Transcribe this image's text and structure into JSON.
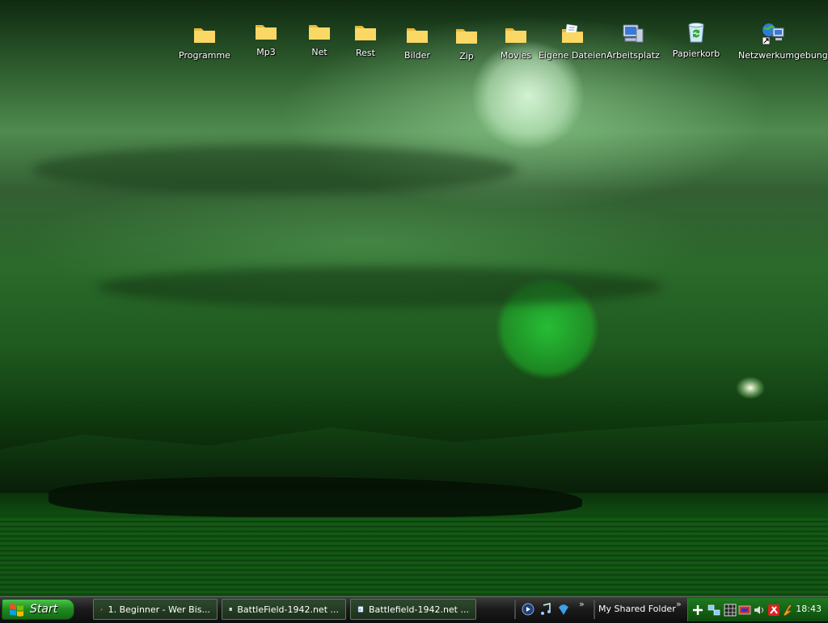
{
  "desktop": {
    "icons": [
      {
        "label": "Programme",
        "icon": "folder-icon"
      },
      {
        "label": "Mp3",
        "icon": "folder-icon"
      },
      {
        "label": "Net",
        "icon": "folder-icon"
      },
      {
        "label": "Rest",
        "icon": "folder-icon"
      },
      {
        "label": "Bilder",
        "icon": "folder-icon"
      },
      {
        "label": "Zip",
        "icon": "folder-icon"
      },
      {
        "label": "Movies",
        "icon": "folder-icon"
      },
      {
        "label": "Eigene Dateien",
        "icon": "my-documents-icon"
      },
      {
        "label": "Arbeitsplatz",
        "icon": "my-computer-icon"
      },
      {
        "label": "Papierkorb",
        "icon": "recycle-bin-icon"
      },
      {
        "label": "Netzwerkumgebung",
        "icon": "network-places-icon"
      }
    ]
  },
  "taskbar": {
    "start_label": "Start",
    "tasks": [
      {
        "label": "1. Beginner - Wer Bis...",
        "icon": "flashget-icon"
      },
      {
        "label": "BattleField-1942.net ...",
        "icon": "ie-page-icon"
      },
      {
        "label": "Battlefield-1942.net ...",
        "icon": "ie-page-icon"
      }
    ],
    "quick_launch_chevron": "»",
    "shared_folder_label": "My Shared Folder",
    "shared_chevron": "»",
    "clock": "18:43"
  },
  "colors": {
    "start_green": "#1f8a1f",
    "tray_green": "#0d4a0d",
    "task_bg": "#1c2f1c"
  }
}
